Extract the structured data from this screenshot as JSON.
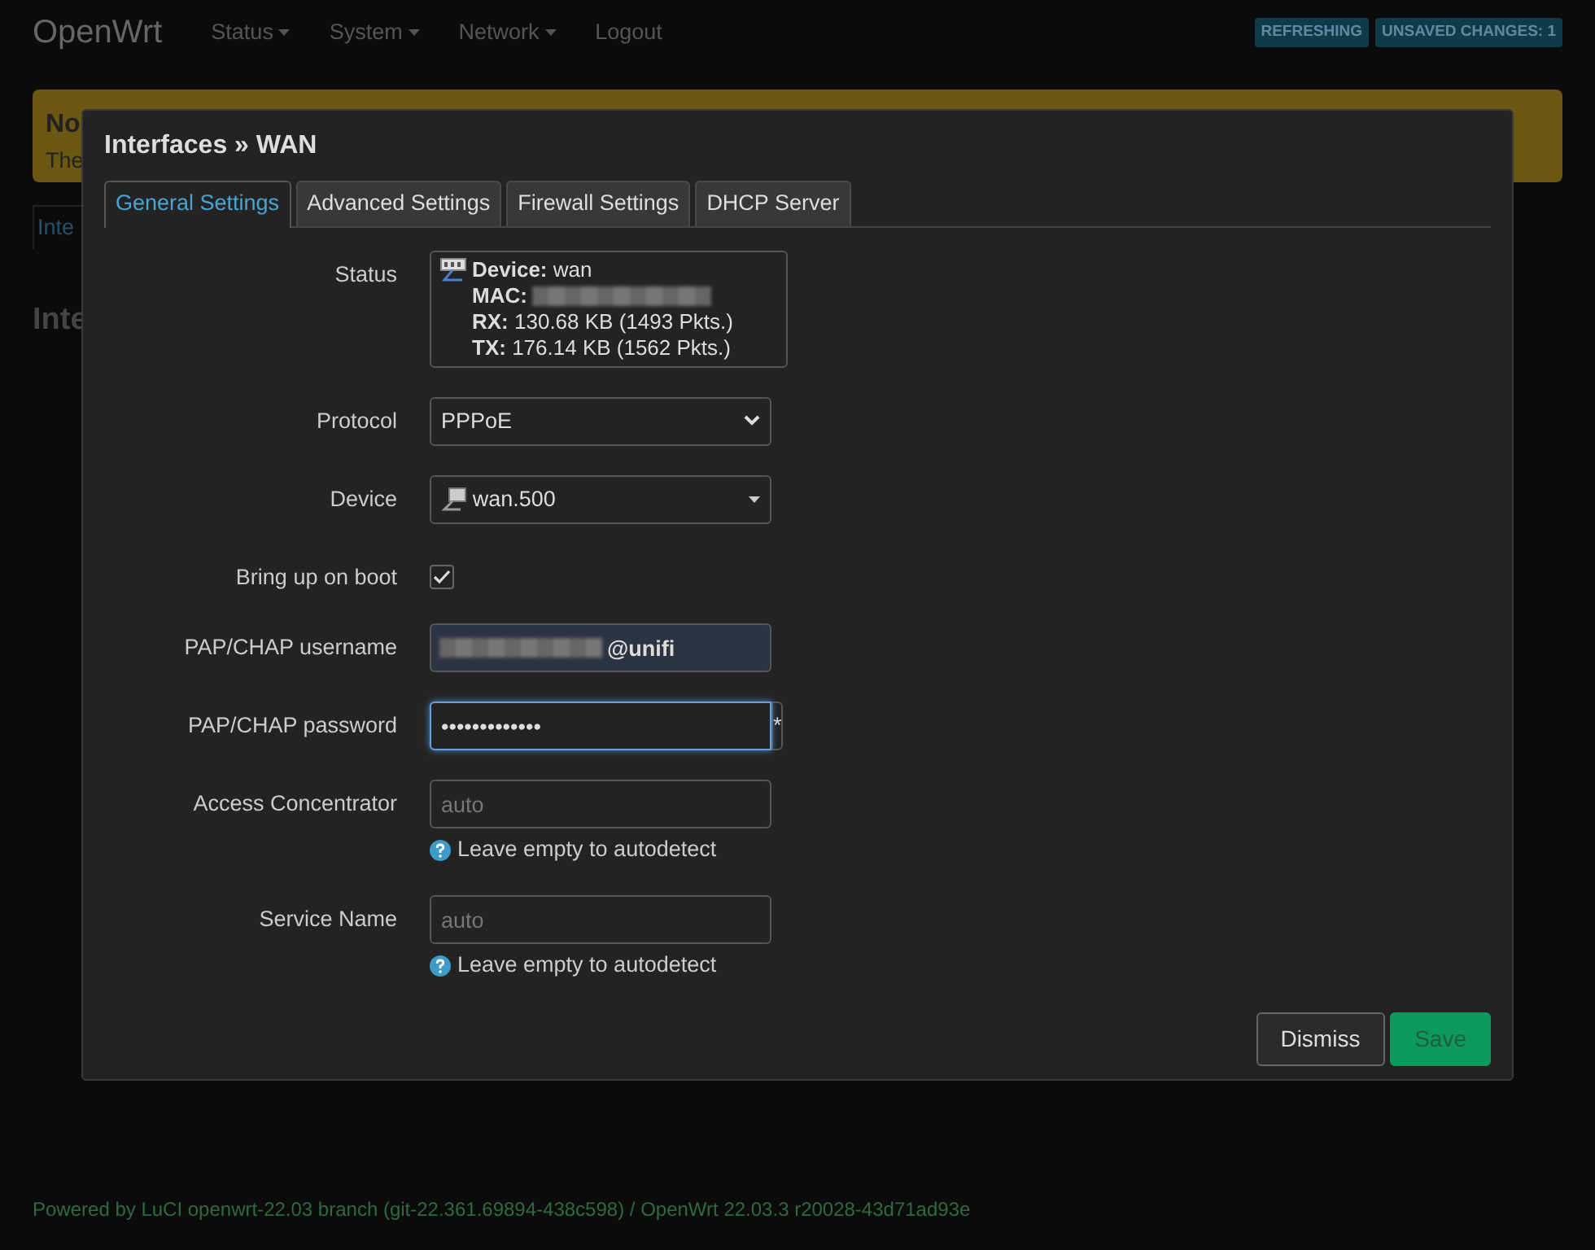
{
  "navbar": {
    "brand": "OpenWrt",
    "menus": [
      {
        "label": "Status",
        "dropdown": true
      },
      {
        "label": "System",
        "dropdown": true
      },
      {
        "label": "Network",
        "dropdown": true
      },
      {
        "label": "Logout",
        "dropdown": false
      }
    ],
    "badges": [
      "REFRESHING",
      "UNSAVED CHANGES: 1"
    ]
  },
  "background": {
    "alert_title": "No",
    "alert_text": "The",
    "tab": "Inte",
    "heading": "Inte"
  },
  "modal": {
    "title": "Interfaces » WAN",
    "tabs": [
      {
        "label": "General Settings",
        "selected": true
      },
      {
        "label": "Advanced Settings",
        "selected": false
      },
      {
        "label": "Firewall Settings",
        "selected": false
      },
      {
        "label": "DHCP Server",
        "selected": false
      }
    ],
    "fields": [
      {
        "kind": "status",
        "label": "Status",
        "lines": [
          {
            "key": "Device:",
            "value": "wan",
            "blurred": false
          },
          {
            "key": "MAC:",
            "blurred": true
          },
          {
            "key": "RX:",
            "value": "130.68 KB (1493 Pkts.)",
            "blurred": false
          },
          {
            "key": "TX:",
            "value": "176.14 KB (1562 Pkts.)",
            "blurred": false
          }
        ]
      },
      {
        "kind": "select",
        "label": "Protocol",
        "value": "PPPoE"
      },
      {
        "kind": "device",
        "label": "Device",
        "value": "wan.500"
      },
      {
        "kind": "checkbox",
        "label": "Bring up on boot",
        "checked": true
      },
      {
        "kind": "text",
        "label": "PAP/CHAP username",
        "value": "@unifi",
        "blurred": true,
        "autofilled": true
      },
      {
        "kind": "password",
        "label": "PAP/CHAP password",
        "value": "•••••••••••••",
        "reveal": "*",
        "focused": true
      },
      {
        "kind": "text",
        "label": "Access Concentrator",
        "placeholder": "auto",
        "help": "Leave empty to autodetect"
      },
      {
        "kind": "text",
        "label": "Service Name",
        "placeholder": "auto",
        "help": "Leave empty to autodetect"
      }
    ],
    "buttons": [
      {
        "label": "Dismiss",
        "kind": "secondary"
      },
      {
        "label": "Save",
        "kind": "primary"
      }
    ]
  },
  "footer": "Powered by LuCI openwrt-22.03 branch (git-22.361.69894-438c598) / OpenWrt 22.03.3 r20028-43d71ad93e"
}
